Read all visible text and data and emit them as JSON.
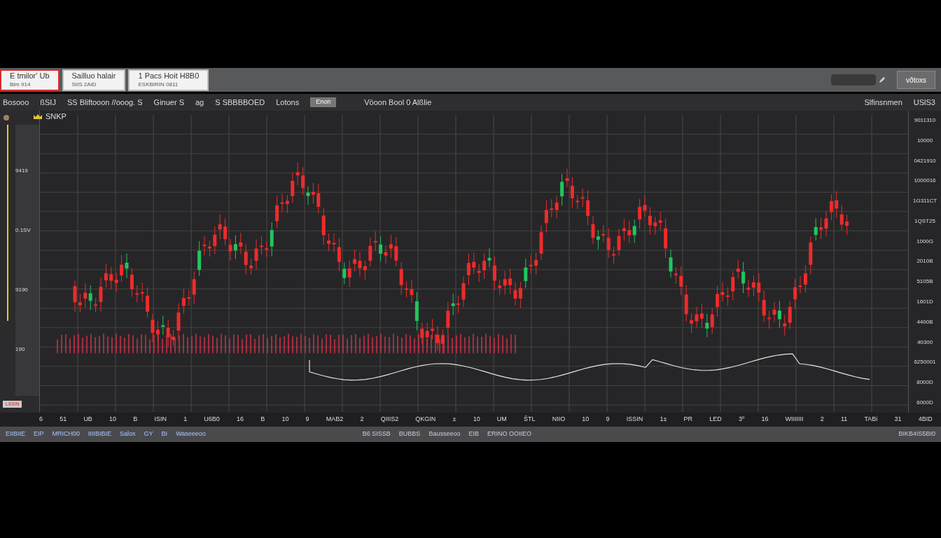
{
  "tabs": [
    {
      "title": "E tmilor' Ub",
      "subtitle": "Bim 914",
      "selected": true
    },
    {
      "title": "Sailluo halair",
      "subtitle": "SIIS 2AID",
      "selected": false
    },
    {
      "title": "1 Pacs Hoit H8B0",
      "subtitle": "ESKBIRIN 0811",
      "selected": false
    }
  ],
  "toolbar": {
    "button": "vðtoxs"
  },
  "header": {
    "items": [
      "Bosooo",
      "ßSIJ",
      "SS Bliftooon //ooog. S",
      "Ginuer S",
      "ag",
      "S SBBBBOED",
      "Lotons"
    ],
    "button": "Enon",
    "caption": "Vöoon Bool 0 Alßlie",
    "right_label": "Slfinsnmen",
    "right_value": "USlS3"
  },
  "symbol": {
    "name": "SNKP"
  },
  "left_panel": {
    "labels": [
      "9419",
      "0.1SV",
      "9190",
      "190"
    ],
    "marker": "LIISIN"
  },
  "y_axis": [
    "9011310",
    "10000",
    "0421910",
    "1000016",
    "1G311CT",
    "1QST25",
    "1000G",
    "2010B",
    "5105B",
    "1601D",
    "4400B",
    "40300",
    "6250001",
    "8000D",
    "6000D"
  ],
  "x_axis": [
    "6",
    "51",
    "UB",
    "10",
    "B",
    "ISIN",
    "1",
    "U6B0",
    "16",
    "B",
    "10",
    "9",
    "MAB2",
    "2",
    "QIIIS2",
    "QKGIN",
    "±",
    "10",
    "UM",
    "ŠTL",
    "NIIO",
    "10",
    "9",
    "ISSIN",
    "1±",
    "PR",
    "LED",
    "3º",
    "16",
    "WIIIIIII",
    "2",
    "11",
    "TABi",
    "31",
    "4BID"
  ],
  "status_bar": {
    "left": [
      "EIIBIIE",
      "EIP",
      "MRICH00",
      "8IIBIBIE",
      "Salos",
      "GY",
      "BI",
      "Waseeeoo"
    ],
    "middle": [
      "B6 SISSB",
      "BUBBS",
      "Bausseeoo",
      "EIB",
      "ERINO OOIIEO"
    ],
    "right": "BIKB4IS5BI0"
  }
}
